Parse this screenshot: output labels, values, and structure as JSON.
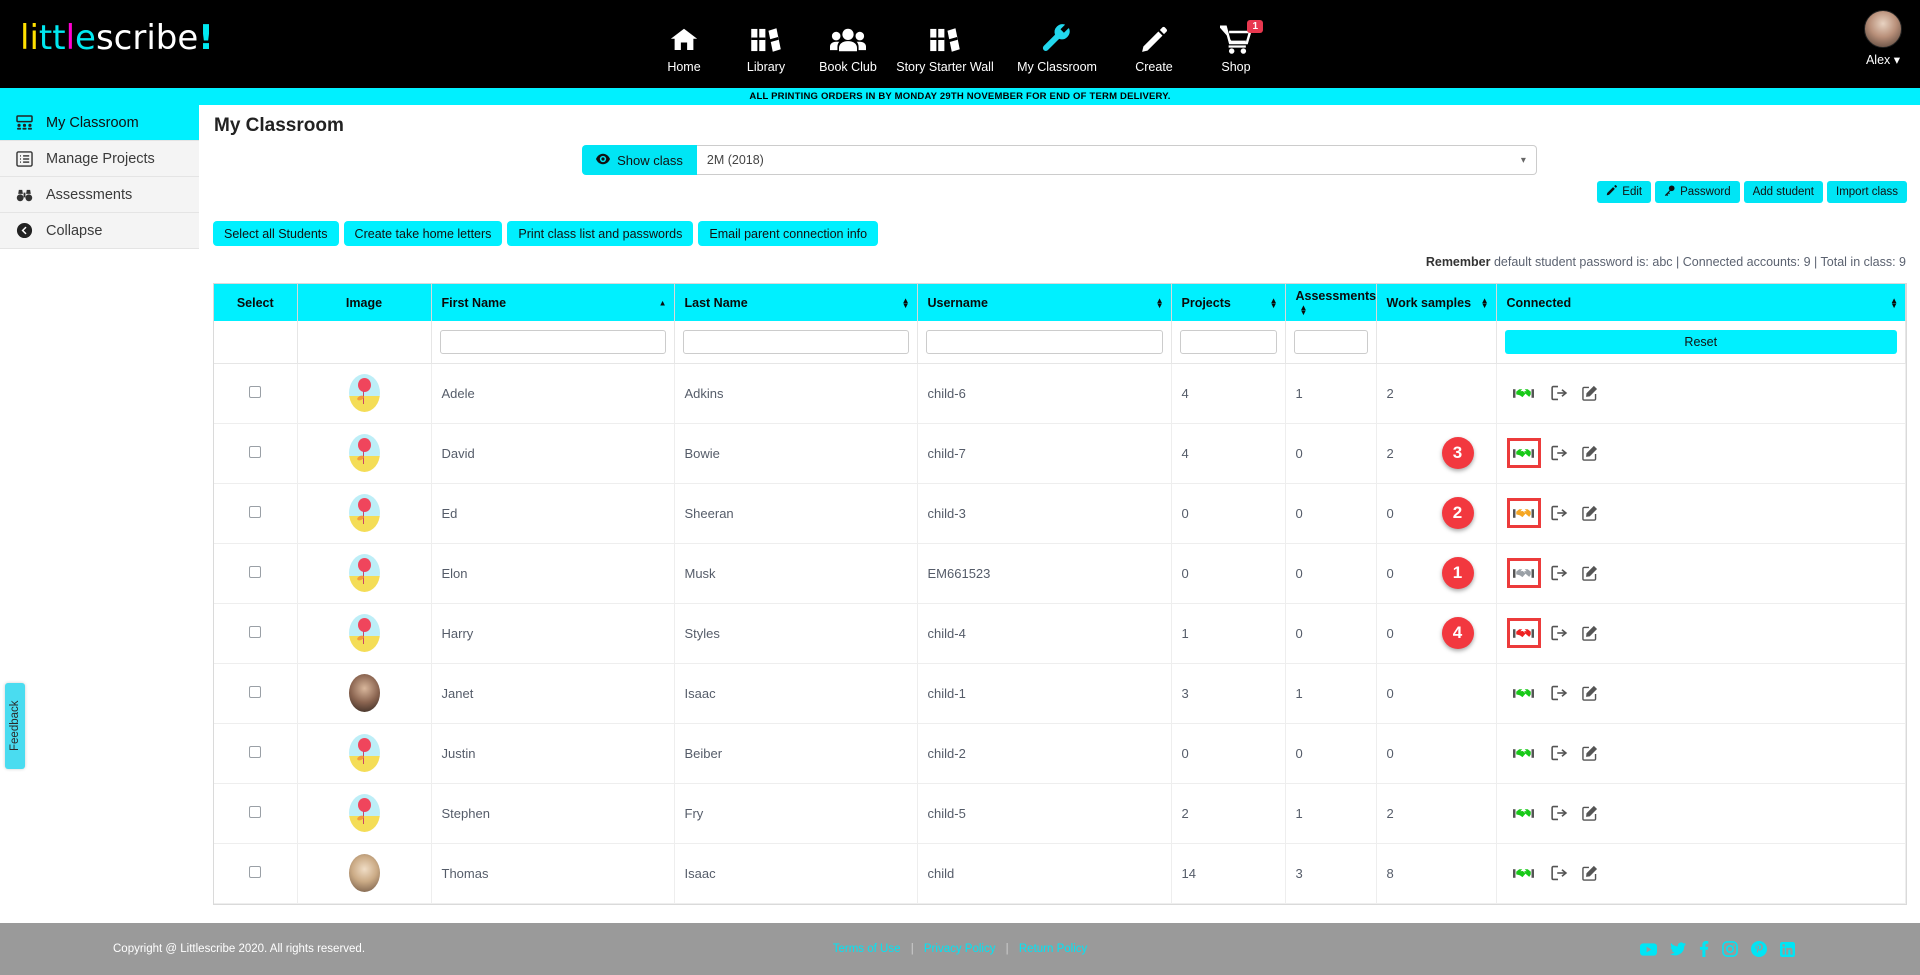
{
  "brand": {
    "logo_text": "littlescribe!",
    "accent": "#00f0ff",
    "dark": "#000000",
    "danger": "#f2383f"
  },
  "topnav": {
    "items": [
      {
        "label": "Home",
        "icon": "home-icon",
        "active": false
      },
      {
        "label": "Library",
        "icon": "books-icon",
        "active": false
      },
      {
        "label": "Book Club",
        "icon": "people-icon",
        "active": false
      },
      {
        "label": "Story Starter Wall",
        "icon": "books-icon",
        "active": false
      },
      {
        "label": "My Classroom",
        "icon": "wrench-icon",
        "active": true
      },
      {
        "label": "Create",
        "icon": "pencil-icon",
        "active": false
      },
      {
        "label": "Shop",
        "icon": "cart-icon",
        "active": false,
        "badge": "1"
      }
    ],
    "user": {
      "name": "Alex",
      "caret": "▾"
    }
  },
  "notice": {
    "text": "ALL PRINTING ORDERS IN BY MONDAY 29TH NOVEMBER FOR END OF TERM DELIVERY."
  },
  "sidebar": {
    "items": [
      {
        "label": "My Classroom",
        "icon": "classroom-icon",
        "active": true
      },
      {
        "label": "Manage Projects",
        "icon": "list-icon",
        "active": false
      },
      {
        "label": "Assessments",
        "icon": "binoculars-icon",
        "active": false
      },
      {
        "label": "Collapse",
        "icon": "collapse-left-icon",
        "active": false
      }
    ],
    "feedback_tab": "Feedback"
  },
  "main": {
    "page_title": "My Classroom",
    "show_class_button": "Show class",
    "class_select_value": "2M (2018)",
    "manage_buttons": [
      {
        "label": "Edit",
        "icon": "edit-pencil-icon"
      },
      {
        "label": "Password",
        "icon": "key-icon"
      },
      {
        "label": "Add student",
        "icon": null
      },
      {
        "label": "Import class",
        "icon": null
      }
    ],
    "action_buttons": [
      "Select all Students",
      "Create take home letters",
      "Print class list and passwords",
      "Email parent connection info"
    ],
    "remember_line": {
      "prefix_bold": "Remember",
      "text": " default student password is: abc | Connected accounts: 9 | Total in class: 9"
    }
  },
  "table": {
    "columns": [
      {
        "label": "Select",
        "sort": "none",
        "align": "center"
      },
      {
        "label": "Image",
        "sort": "none",
        "align": "center"
      },
      {
        "label": "First Name",
        "sort": "asc",
        "align": "left"
      },
      {
        "label": "Last Name",
        "sort": "both",
        "align": "left"
      },
      {
        "label": "Username",
        "sort": "both",
        "align": "left"
      },
      {
        "label": "Projects",
        "sort": "both",
        "align": "left"
      },
      {
        "label": "Assessments",
        "sort": "both",
        "align": "left"
      },
      {
        "label": "Work samples",
        "sort": "both",
        "align": "left"
      },
      {
        "label": "Connected",
        "sort": "both",
        "align": "left"
      }
    ],
    "filters": {
      "first_name": "",
      "last_name": "",
      "username": "",
      "projects": "",
      "assessments": "",
      "reset_label": "Reset"
    },
    "rows": [
      {
        "first_name": "Adele",
        "last_name": "Adkins",
        "username": "child-6",
        "projects": "4",
        "assessments": "1",
        "work_samples": "2",
        "connected_status": "green",
        "avatar": "illustration",
        "highlight": false,
        "marker": null
      },
      {
        "first_name": "David",
        "last_name": "Bowie",
        "username": "child-7",
        "projects": "4",
        "assessments": "0",
        "work_samples": "2",
        "connected_status": "green",
        "avatar": "illustration",
        "highlight": true,
        "marker": "3"
      },
      {
        "first_name": "Ed",
        "last_name": "Sheeran",
        "username": "child-3",
        "projects": "0",
        "assessments": "0",
        "work_samples": "0",
        "connected_status": "orange",
        "avatar": "illustration",
        "highlight": true,
        "marker": "2"
      },
      {
        "first_name": "Elon",
        "last_name": "Musk",
        "username": "EM661523",
        "projects": "0",
        "assessments": "0",
        "work_samples": "0",
        "connected_status": "grey",
        "avatar": "illustration",
        "highlight": true,
        "marker": "1"
      },
      {
        "first_name": "Harry",
        "last_name": "Styles",
        "username": "child-4",
        "projects": "1",
        "assessments": "0",
        "work_samples": "0",
        "connected_status": "red",
        "avatar": "illustration",
        "highlight": true,
        "marker": "4"
      },
      {
        "first_name": "Janet",
        "last_name": "Isaac",
        "username": "child-1",
        "projects": "3",
        "assessments": "1",
        "work_samples": "0",
        "connected_status": "green",
        "avatar": "photo",
        "highlight": false,
        "marker": null
      },
      {
        "first_name": "Justin",
        "last_name": "Beiber",
        "username": "child-2",
        "projects": "0",
        "assessments": "0",
        "work_samples": "0",
        "connected_status": "green",
        "avatar": "illustration",
        "highlight": false,
        "marker": null
      },
      {
        "first_name": "Stephen",
        "last_name": "Fry",
        "username": "child-5",
        "projects": "2",
        "assessments": "1",
        "work_samples": "2",
        "connected_status": "green",
        "avatar": "illustration",
        "highlight": false,
        "marker": null
      },
      {
        "first_name": "Thomas",
        "last_name": "Isaac",
        "username": "child",
        "projects": "14",
        "assessments": "3",
        "work_samples": "8",
        "connected_status": "green",
        "avatar": "photo2",
        "highlight": false,
        "marker": null
      }
    ],
    "status_colors": {
      "green": "#18c818",
      "orange": "#f5a623",
      "grey": "#9aa0a6",
      "red": "#ee2222"
    }
  },
  "footer": {
    "copyright": "Copyright @ Littlescribe 2020. All rights reserved.",
    "links": [
      "Terms of Use",
      "Privacy Policy",
      "Return Policy"
    ],
    "social": [
      "youtube-icon",
      "twitter-icon",
      "facebook-icon",
      "instagram-icon",
      "pinterest-icon",
      "linkedin-icon"
    ]
  }
}
